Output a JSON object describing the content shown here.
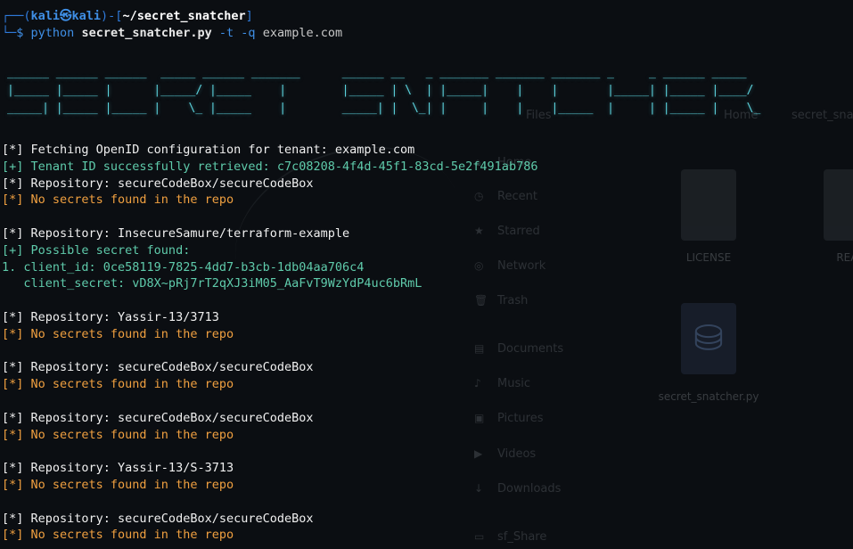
{
  "prompt": {
    "user": "kali",
    "host": "kali",
    "cwd": "~/secret_snatcher",
    "symbol": "$",
    "command": "python",
    "script_pre": "se",
    "script_hl": "cret_snatcher.py",
    "flags": "-t -q",
    "target": "example.com"
  },
  "banner": {
    "line1": "______ ______ ______  _____ ______ _______      ______ __   _ _______ _______ _______ _     _ ______ _____",
    "line2": "|_____ |_____ |      |_____/ |_____    |        |_____ | \\  | |_____|    |    |       |_____| |_____ |____/",
    "line3": "_____| |_____ |_____ |    \\_ |_____    |        _____| |  \\_| |     |    |    |_____  |     | |_____ |    \\_"
  },
  "output": [
    {
      "text": "[*] Fetching OpenID configuration for tenant: example.com",
      "color": "white"
    },
    {
      "text": "[+] Tenant ID successfully retrieved: c7c08208-4f4d-45f1-83cd-5e2f491ab786",
      "color": "green"
    },
    {
      "text": "[*] Repository: secureCodeBox/secureCodeBox",
      "color": "white"
    },
    {
      "text": "[*] No secrets found in the repo",
      "color": "orange"
    },
    {
      "text": "",
      "color": "white"
    },
    {
      "text": "[*] Repository: InsecureSamure/terraform-example",
      "color": "white"
    },
    {
      "text": "[+] Possible secret found:",
      "color": "green"
    },
    {
      "text": "1. client_id: 0ce58119-7825-4dd7-b3cb-1db04aa706c4",
      "color": "green"
    },
    {
      "text": "   client_secret: vD8X~pRj7rT2qXJ3iM05_AaFvT9WzYdP4uc6bRmL",
      "color": "green"
    },
    {
      "text": "",
      "color": "white"
    },
    {
      "text": "[*] Repository: Yassir-13/3713",
      "color": "white"
    },
    {
      "text": "[*] No secrets found in the repo",
      "color": "orange"
    },
    {
      "text": "",
      "color": "white"
    },
    {
      "text": "[*] Repository: secureCodeBox/secureCodeBox",
      "color": "white"
    },
    {
      "text": "[*] No secrets found in the repo",
      "color": "orange"
    },
    {
      "text": "",
      "color": "white"
    },
    {
      "text": "[*] Repository: secureCodeBox/secureCodeBox",
      "color": "white"
    },
    {
      "text": "[*] No secrets found in the repo",
      "color": "orange"
    },
    {
      "text": "",
      "color": "white"
    },
    {
      "text": "[*] Repository: Yassir-13/S-3713",
      "color": "white"
    },
    {
      "text": "[*] No secrets found in the repo",
      "color": "orange"
    },
    {
      "text": "",
      "color": "white"
    },
    {
      "text": "[*] Repository: secureCodeBox/secureCodeBox",
      "color": "white"
    },
    {
      "text": "[*] No secrets found in the repo",
      "color": "orange"
    }
  ],
  "background": {
    "tabs": [
      "Files",
      "Home",
      "secret_snat"
    ],
    "sidebar": [
      "Home",
      "Recent",
      "Starred",
      "Network",
      "Trash",
      "Documents",
      "Music",
      "Pictures",
      "Videos",
      "Downloads",
      "sf_Share"
    ],
    "files": [
      {
        "name": "LICENSE",
        "icon": "document-icon"
      },
      {
        "name": "READ",
        "icon": "document-icon"
      },
      {
        "name": "secret_snatcher.py",
        "icon": "python-file-icon"
      }
    ]
  }
}
